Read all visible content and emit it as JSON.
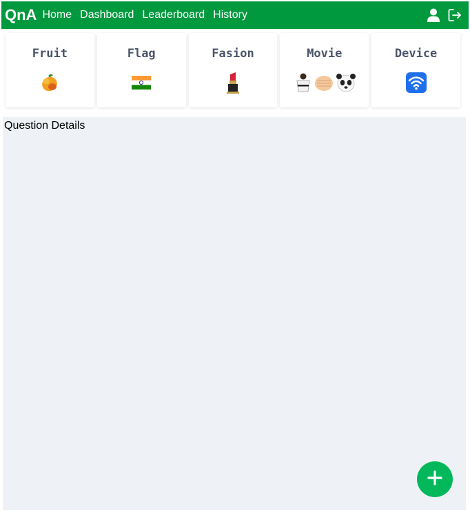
{
  "header": {
    "brand": "QnA",
    "links": [
      "Home",
      "Dashboard",
      "Leaderboard",
      "History"
    ],
    "icons": [
      "user-icon",
      "logout-icon"
    ]
  },
  "categories": [
    {
      "title": "Fruit",
      "icon": "mango-icon"
    },
    {
      "title": "Flag",
      "icon": "india-flag-icon"
    },
    {
      "title": "Fasion",
      "icon": "lipstick-icon"
    },
    {
      "title": "Movie",
      "icon": "karate-fist-panda-icons"
    },
    {
      "title": "Device",
      "icon": "wifi-icon"
    }
  ],
  "main": {
    "section_title": "Question Details"
  },
  "fab": {
    "icon": "plus-icon"
  },
  "colors": {
    "navbar": "#01993e",
    "fab": "#02b85a",
    "panel_bg": "#eef2f6",
    "card_title": "#4a5568"
  }
}
